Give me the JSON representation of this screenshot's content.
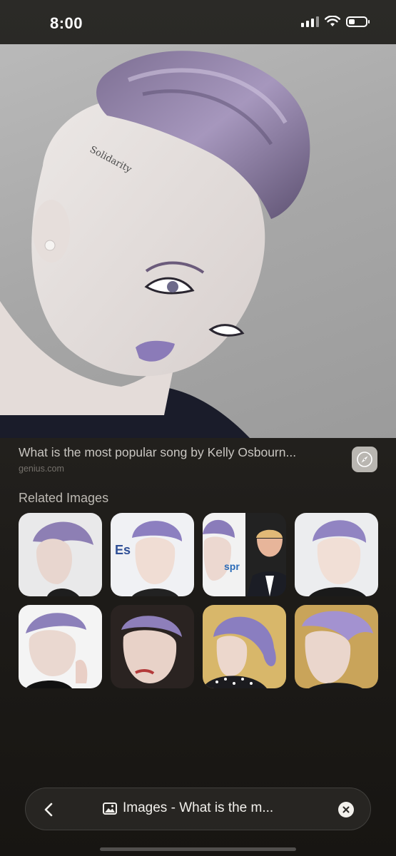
{
  "status_bar": {
    "time": "8:00"
  },
  "result": {
    "title": "What is the most popular song by Kelly Osbourn...",
    "domain": "genius.com",
    "tattoo_text": "Solidarity"
  },
  "related": {
    "heading": "Related Images",
    "thumbnails": [
      {
        "label": "related-image-1"
      },
      {
        "label": "related-image-2"
      },
      {
        "label": "related-image-3"
      },
      {
        "label": "related-image-4"
      },
      {
        "label": "related-image-5"
      },
      {
        "label": "related-image-6"
      },
      {
        "label": "related-image-7"
      },
      {
        "label": "related-image-8"
      }
    ]
  },
  "bottom_bar": {
    "title": "Images - What is the m..."
  },
  "colors": {
    "accent_purple": "#8b7bb8",
    "hair_lavender": "#9c8fb5"
  },
  "icons": [
    "wifi-icon",
    "signal-icon",
    "battery-icon",
    "safari-icon",
    "back-chevron-icon",
    "image-icon",
    "close-icon"
  ]
}
